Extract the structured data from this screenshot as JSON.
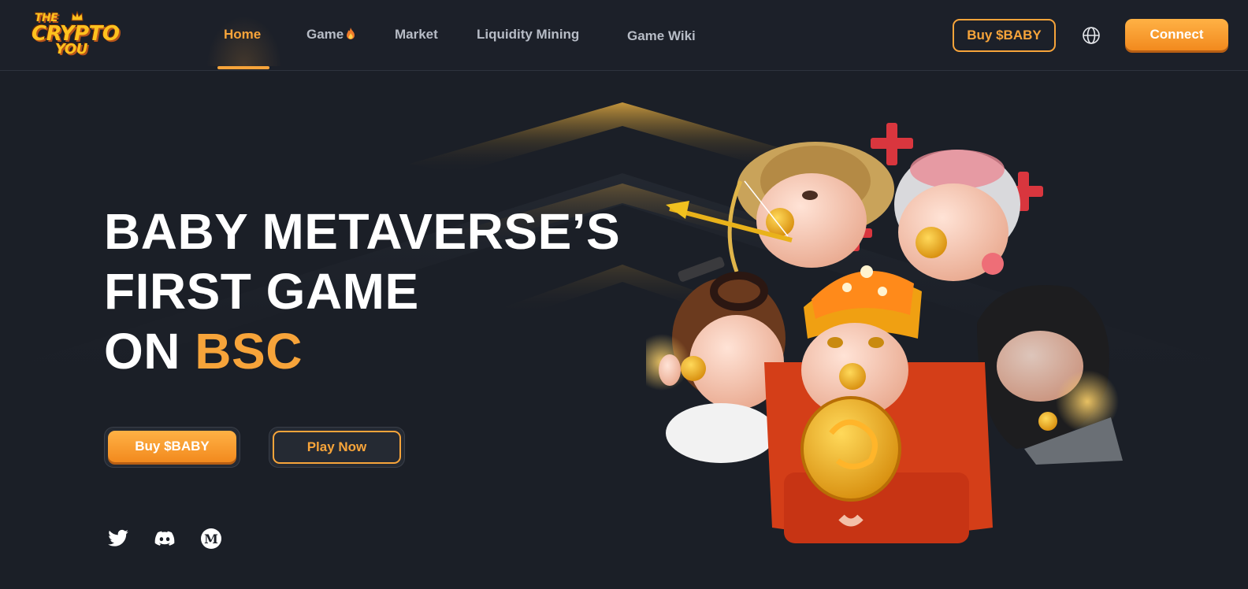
{
  "header": {
    "logo": {
      "line1": "THE",
      "line2": "CRYPTO",
      "line3": "YOU"
    },
    "nav": [
      {
        "label": "Home",
        "active": true
      },
      {
        "label": "Game",
        "icon": "fire-icon"
      },
      {
        "label": "Market"
      },
      {
        "label": "Liquidity Mining"
      },
      {
        "label": "Game Wiki"
      }
    ],
    "buy_label": "Buy $BABY",
    "globe_icon": "globe-icon",
    "connect_label": "Connect"
  },
  "hero": {
    "title_line1": "BABY METAVERSE’S",
    "title_line2": "FIRST GAME",
    "title_line3_prefix": "ON ",
    "title_line3_accent": "BSC",
    "buy_label": "Buy $BABY",
    "play_label": "Play Now",
    "social": [
      "twitter-icon",
      "discord-icon",
      "medium-icon"
    ]
  },
  "colors": {
    "background": "#1b1f27",
    "accent": "#f7a43a",
    "nav_text": "#b7bcc6"
  }
}
